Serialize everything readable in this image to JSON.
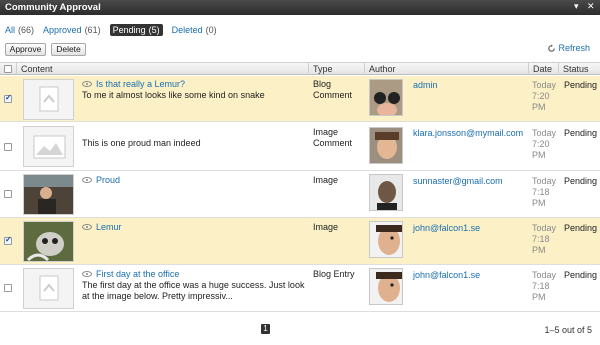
{
  "window": {
    "title": "Community Approval"
  },
  "filters": [
    {
      "label": "All",
      "count": "(66)"
    },
    {
      "label": "Approved",
      "count": "(61)"
    },
    {
      "label": "Pending",
      "count": "(5)"
    },
    {
      "label": "Deleted",
      "count": "(0)"
    }
  ],
  "toolbar": {
    "approve_label": "Approve",
    "delete_label": "Delete",
    "refresh_label": "Refresh"
  },
  "table": {
    "headers": {
      "content": "Content",
      "type": "Type",
      "author": "Author",
      "date": "Date",
      "status": "Status"
    },
    "rows": [
      {
        "selected": true,
        "title": "Is that really a Lemur?",
        "body1": "To me it almost looks like some kind on snake",
        "body2": "",
        "type1": "Blog",
        "type2": "Comment",
        "author": "admin",
        "date1": "Today",
        "date2": "7:20",
        "date3": "PM",
        "status": "Pending"
      },
      {
        "selected": false,
        "title": "",
        "body1": "This is one proud man indeed",
        "body2": "",
        "type1": "Image",
        "type2": "Comment",
        "author": "klara.jonsson@mymail.com",
        "date1": "Today",
        "date2": "7:20",
        "date3": "PM",
        "status": "Pending"
      },
      {
        "selected": false,
        "title": "Proud",
        "body1": "",
        "body2": "",
        "type1": "Image",
        "type2": "",
        "author": "sunnaster@gmail.com",
        "date1": "Today",
        "date2": "7:18",
        "date3": "PM",
        "status": "Pending"
      },
      {
        "selected": true,
        "title": "Lemur",
        "body1": "",
        "body2": "",
        "type1": "Image",
        "type2": "",
        "author": "john@falcon1.se",
        "date1": "Today",
        "date2": "7:18",
        "date3": "PM",
        "status": "Pending"
      },
      {
        "selected": false,
        "title": "First day at the office",
        "body1": "The first day at the office was a huge success. Just look",
        "body2": "at the image below. Pretty impressiv...",
        "type1": "Blog Entry",
        "type2": "",
        "author": "john@falcon1.se",
        "date1": "Today",
        "date2": "7:18",
        "date3": "PM",
        "status": "Pending"
      }
    ]
  },
  "pagination": {
    "current": "1",
    "range": "1–5 out of 5"
  },
  "colors": {
    "selected_row": "#fbf0c6",
    "link": "#1a6fb0",
    "titlebar": "#333333"
  }
}
